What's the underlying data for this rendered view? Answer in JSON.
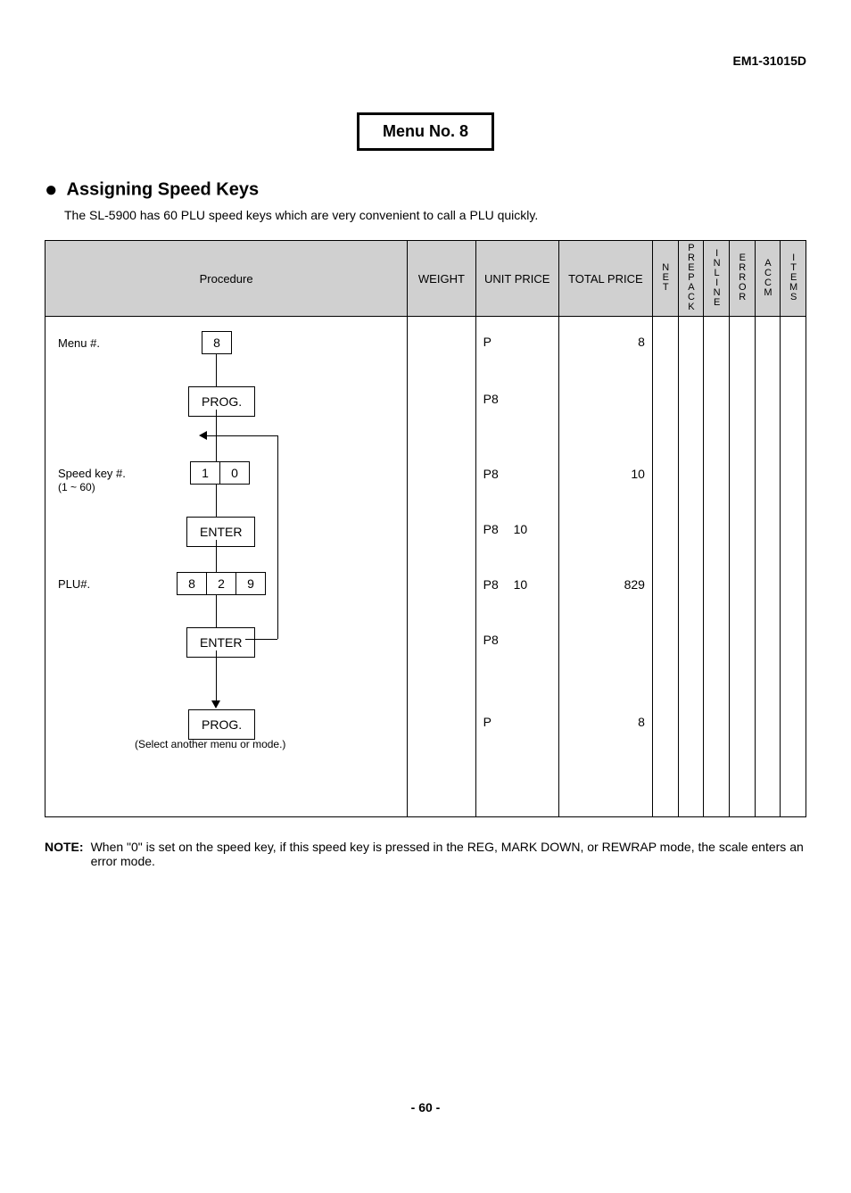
{
  "doc_id": "EM1-31015D",
  "menu_box": "Menu No. 8",
  "section_title": "Assigning Speed Keys",
  "intro": "The SL-5900 has 60 PLU speed keys which are very convenient to call a PLU quickly.",
  "headers": {
    "procedure": "Procedure",
    "weight": "WEIGHT",
    "unit_price": "UNIT PRICE",
    "total_price": "TOTAL PRICE",
    "net": "NET",
    "prepack": "PREPACK",
    "inline": "INLINE",
    "error": "ERROR",
    "accm": "ACCM",
    "items": "ITEMS"
  },
  "labels": {
    "menu_no": "Menu #.",
    "speed_key": "Speed key #.",
    "speed_key_range": "(1 ~ 60)",
    "plu_no": "PLU#.",
    "select_note": "(Select another menu or mode.)"
  },
  "keys": {
    "k8": "8",
    "prog": "PROG.",
    "k1": "1",
    "k0": "0",
    "enter": "ENTER",
    "k2": "2",
    "k9": "9"
  },
  "unit_price_col": {
    "r1a": "P",
    "r2a": "P8",
    "r3a": "P8",
    "r4a": "P8",
    "r4b": "10",
    "r5a": "P8",
    "r5b": "10",
    "r6a": "P8",
    "r7a": "P"
  },
  "total_price_col": {
    "r1": "8",
    "r3": "10",
    "r5": "829",
    "r7": "8"
  },
  "note_label": "NOTE:",
  "note_text": "When \"0\" is set on the speed key, if this speed key is pressed in the REG, MARK DOWN, or REWRAP mode, the scale enters an error mode.",
  "page": "- 60 -"
}
